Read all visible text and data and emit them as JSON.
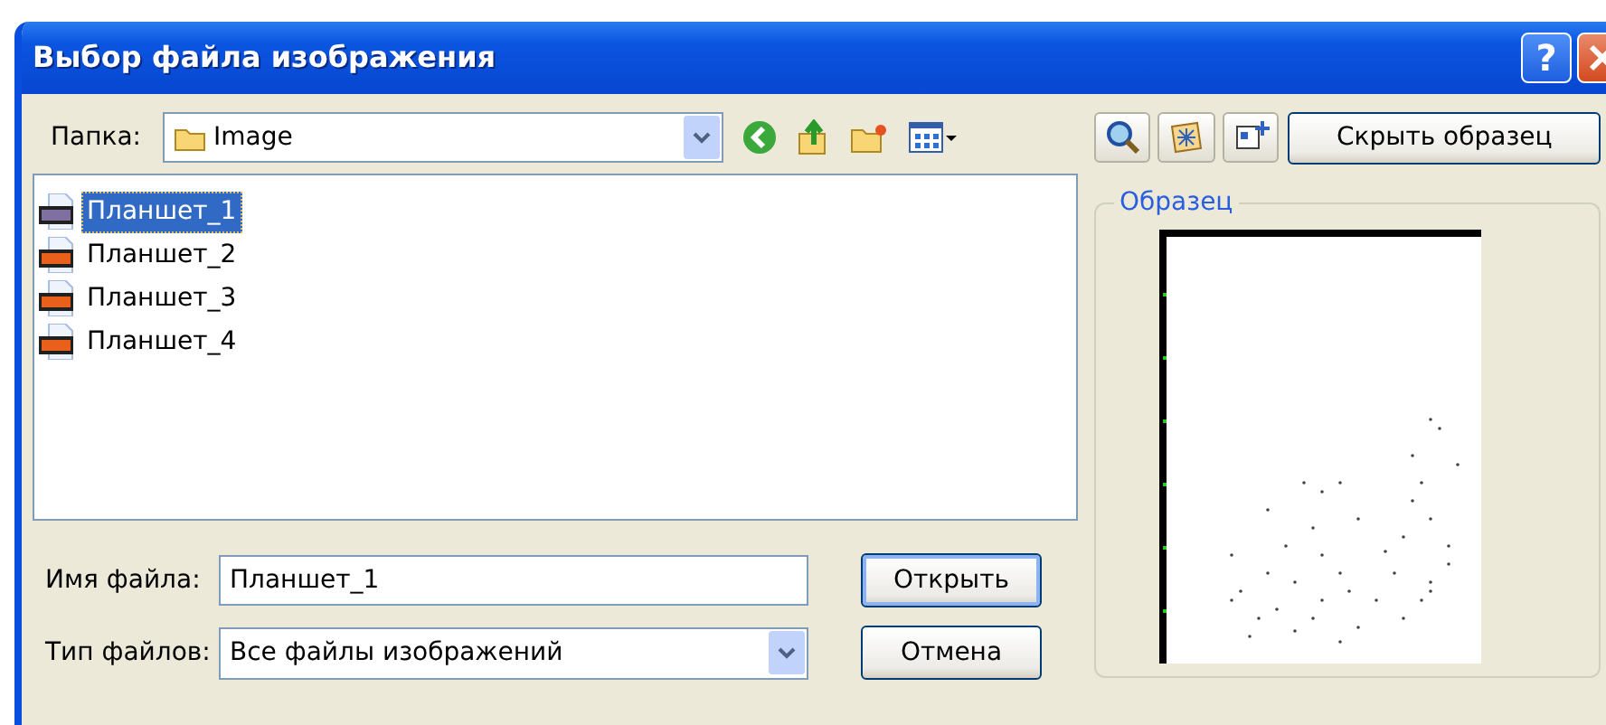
{
  "window": {
    "title": "Выбор файла изображения",
    "help_button": "?"
  },
  "toolbar": {
    "folder_label": "Папка:",
    "folder": "Image"
  },
  "preview_toggle": "Скрыть образец",
  "files": [
    {
      "name": "Планшет_1",
      "selected": true
    },
    {
      "name": "Планшет_2",
      "selected": false
    },
    {
      "name": "Планшет_3",
      "selected": false
    },
    {
      "name": "Планшет_4",
      "selected": false
    }
  ],
  "file_name": {
    "label": "Имя файла:",
    "value": "Планшет_1"
  },
  "file_type": {
    "label": "Тип файлов:",
    "value": "Все файлы изображений"
  },
  "buttons": [
    {
      "label": "Открыть",
      "default": true
    },
    {
      "label": "Отмена",
      "default": false
    }
  ],
  "preview": {
    "title": "Образец"
  }
}
